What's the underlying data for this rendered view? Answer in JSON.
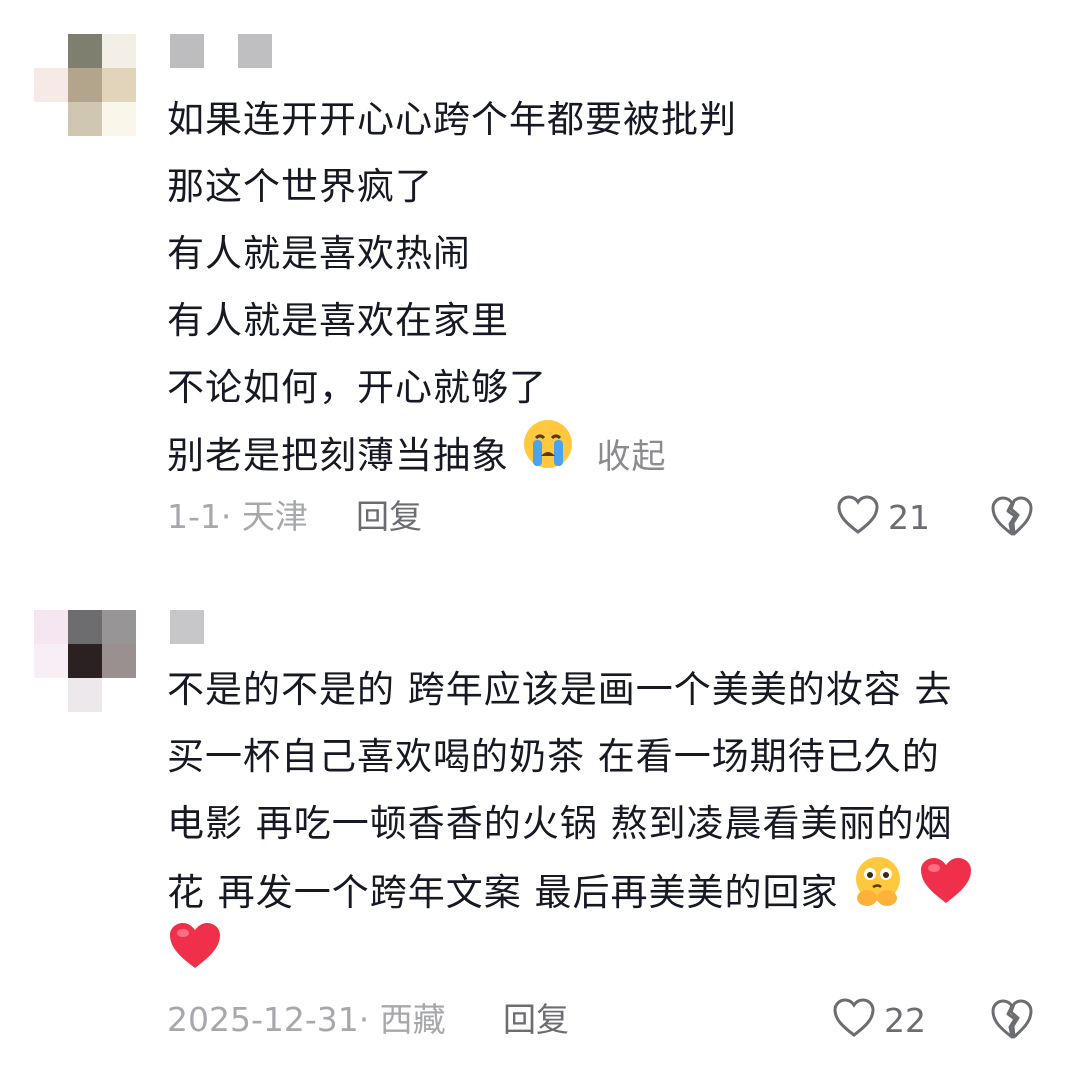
{
  "comments": [
    {
      "lines": [
        "如果连开开心心跨个年都要被批判",
        "那这个世界疯了",
        "有人就是喜欢热闹",
        "有人就是喜欢在家里",
        "不论如何，开心就够了",
        "别老是把刻薄当抽象"
      ],
      "emoji": [
        "crying-face-icon"
      ],
      "collapse_label": "收起",
      "meta": "1-1· 天津",
      "reply_label": "回复",
      "likes": "21"
    },
    {
      "lines": [
        "不是的不是的 跨年应该是画一个美美的妆容 去",
        "买一杯自己喜欢喝的奶茶 在看一场期待已久的",
        "电影 再吃一顿香香的火锅 熬到凌晨看美丽的烟",
        "花 再发一个跨年文案 最后再美美的回家"
      ],
      "emoji": [
        "thinking-face-icon",
        "red-heart-icon",
        "red-heart-icon"
      ],
      "meta": "2025-12-31· 西藏",
      "reply_label": "回复",
      "likes": "22"
    }
  ],
  "colors": {
    "text": "#161823",
    "meta": "#a7a8ad",
    "action": "#6c6d72",
    "collapse": "#8a8b91"
  }
}
